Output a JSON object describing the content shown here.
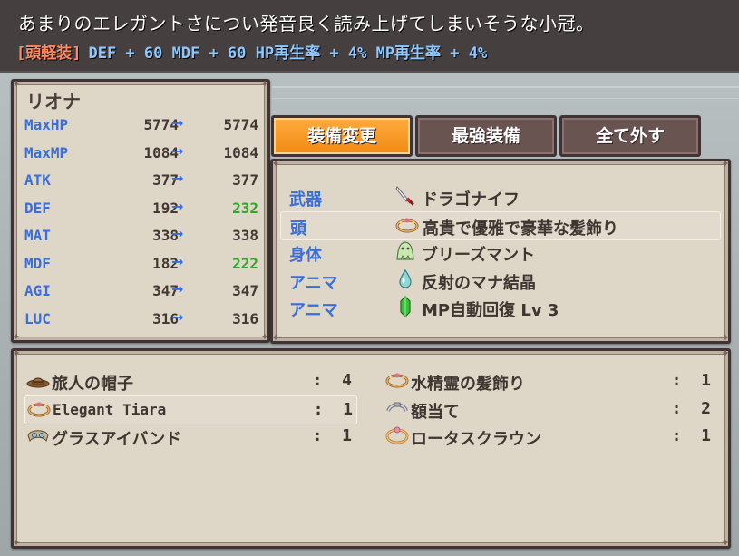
{
  "help": {
    "description": "あまりのエレガントさについ発音良く読み上げてしまいそうな小冠。",
    "category": "[頭軽装]",
    "stats": "DEF + 60 MDF + 60  HP再生率 + 4%  MP再生率 + 4%"
  },
  "actor": {
    "name": "リオナ",
    "arrow": "→",
    "stats": [
      {
        "name": "MaxHP",
        "current": "5774",
        "new": "5774",
        "change": "same"
      },
      {
        "name": "MaxMP",
        "current": "1084",
        "new": "1084",
        "change": "same"
      },
      {
        "name": "ATK",
        "current": "377",
        "new": "377",
        "change": "same"
      },
      {
        "name": "DEF",
        "current": "192",
        "new": "232",
        "change": "up"
      },
      {
        "name": "MAT",
        "current": "338",
        "new": "338",
        "change": "same"
      },
      {
        "name": "MDF",
        "current": "182",
        "new": "222",
        "change": "up"
      },
      {
        "name": "AGI",
        "current": "347",
        "new": "347",
        "change": "same"
      },
      {
        "name": "LUC",
        "current": "316",
        "new": "316",
        "change": "same"
      }
    ]
  },
  "commands": [
    {
      "label": "装備変更",
      "active": true
    },
    {
      "label": "最強装備",
      "active": false
    },
    {
      "label": "全て外す",
      "active": false
    }
  ],
  "slots": [
    {
      "type": "武器",
      "item": "ドラゴナイフ",
      "icon": "knife-icon"
    },
    {
      "type": "頭",
      "item": "高貴で優雅で豪華な髪飾り",
      "icon": "tiara-icon"
    },
    {
      "type": "身体",
      "item": "ブリーズマント",
      "icon": "cloak-icon"
    },
    {
      "type": "アニマ",
      "item": "反射のマナ結晶",
      "icon": "mana-crystal-icon"
    },
    {
      "type": "アニマ",
      "item": "MP自動回復 Lv 3",
      "icon": "green-crystal-icon"
    }
  ],
  "selected_slot": 1,
  "items": [
    {
      "name": "旅人の帽子",
      "count": ":  4",
      "icon": "hat-icon"
    },
    {
      "name": "水精霊の髪飾り",
      "count": ":  1",
      "icon": "tiara-icon"
    },
    {
      "name": "Elegant Tiara",
      "count": ":  1",
      "icon": "tiara-icon"
    },
    {
      "name": "額当て",
      "count": ":  2",
      "icon": "headband-icon"
    },
    {
      "name": "グラスアイバンド",
      "count": ":  1",
      "icon": "eyeband-icon"
    },
    {
      "name": "ロータスクラウン",
      "count": ":  1",
      "icon": "crown-icon"
    }
  ],
  "selected_item": 2,
  "colors": {
    "stat_label": "#3a6ed8",
    "stat_up": "#2ea82a",
    "stat_same": "#423834",
    "category": "#ff8a64",
    "help_stats": "#8ec8ff",
    "active_tab": "#f08a14"
  }
}
